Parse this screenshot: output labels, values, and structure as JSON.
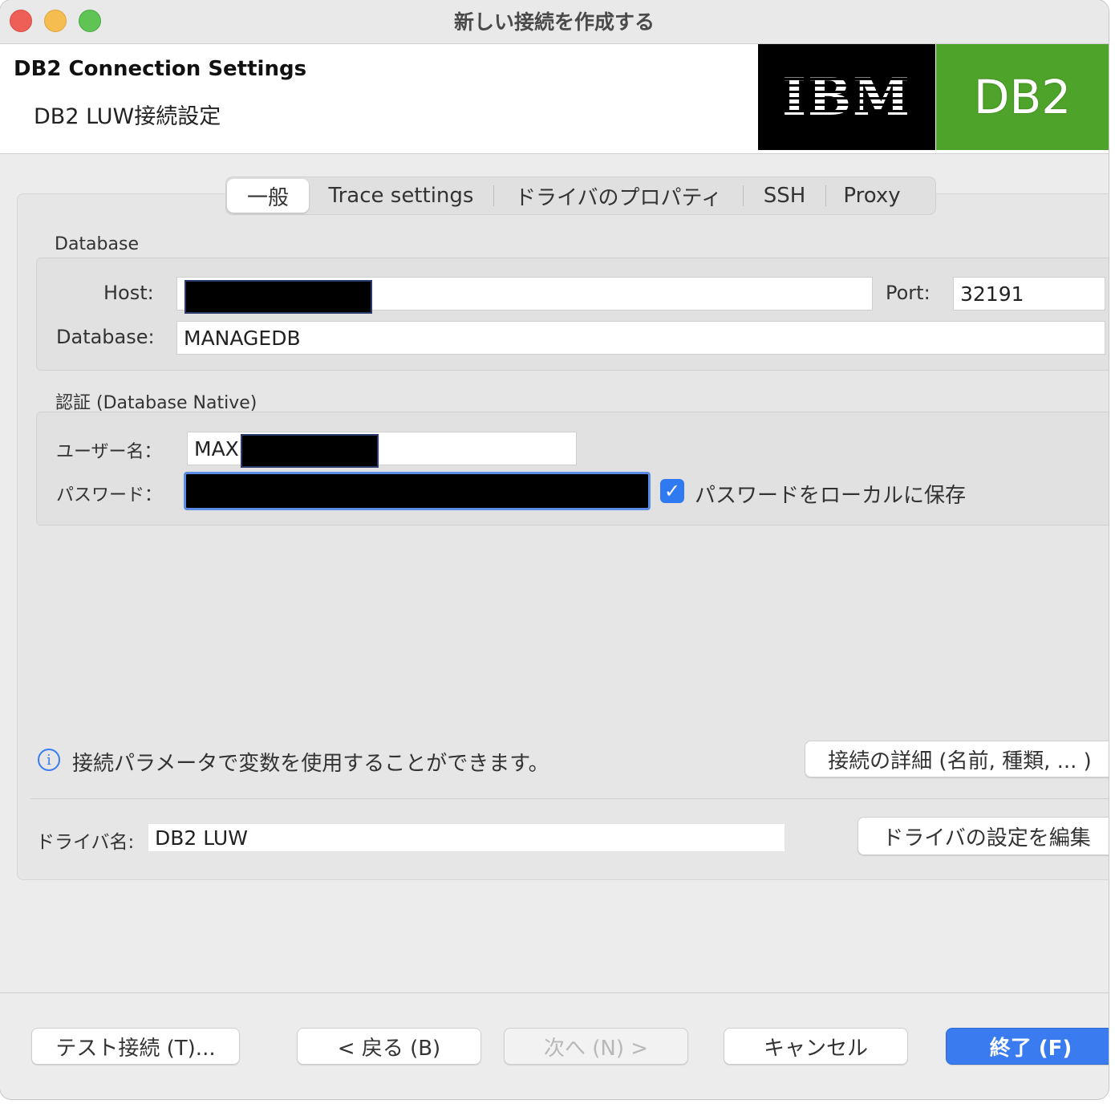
{
  "window": {
    "title": "新しい接続を作成する"
  },
  "header": {
    "title": "DB2 Connection Settings",
    "subtitle": "DB2 LUW接続設定",
    "logo_ibm": "IBM",
    "logo_db2": "DB2"
  },
  "tabs": [
    {
      "label": "一般",
      "active": true
    },
    {
      "label": "Trace settings"
    },
    {
      "label": "ドライバのプロパティ"
    },
    {
      "label": "SSH"
    },
    {
      "label": "Proxy"
    }
  ],
  "database": {
    "group_label": "Database",
    "host_label": "Host:",
    "host_value": "",
    "port_label": "Port:",
    "port_value": "32191",
    "db_label": "Database:",
    "db_value": "MANAGEDB"
  },
  "auth": {
    "group_label": "認証 (Database Native)",
    "user_label": "ユーザー名：",
    "user_value": "MAX",
    "password_label": "パスワード：",
    "save_password_label": "パスワードをローカルに保存",
    "save_password_checked": true
  },
  "info": {
    "text": "接続パラメータで変数を使用することができます。",
    "details_button": "接続の詳細 (名前, 種類, ... )"
  },
  "driver": {
    "label": "ドライバ名:",
    "value": "DB2 LUW",
    "edit_button": "ドライバの設定を編集"
  },
  "footer": {
    "test_button": "テスト接続 (T)...",
    "back_button": "< 戻る (B)",
    "next_button": "次へ (N) >",
    "cancel_button": "キャンセル",
    "finish_button": "終了 (F)"
  },
  "colors": {
    "accent": "#3a7cf0",
    "db2_green": "#4ea32a",
    "ibm_black": "#000000"
  }
}
